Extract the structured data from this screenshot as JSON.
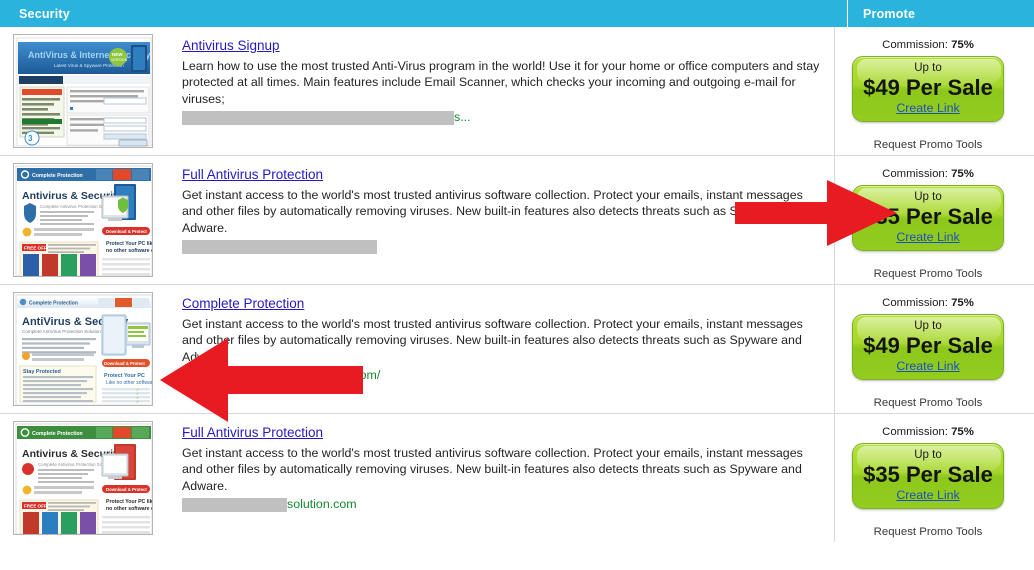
{
  "header": {
    "left_label": "Security",
    "right_label": "Promote"
  },
  "colors": {
    "header_bg": "#2ab4dd",
    "link": "#2419c4",
    "url_green": "#128a2c",
    "button_green": "#93cc1f",
    "arrow_red": "#e81b23",
    "redaction_gray": "#c0c0c0"
  },
  "rows": [
    {
      "thumbnail_name": "antivirus-signup-site-thumbnail",
      "title": "Antivirus Signup",
      "description": "Learn how to use the most trusted Anti-Virus program in the world! Use it for your home or office computers and stay protected at all times. Main features include Email Scanner, which checks your incoming and outgoing e-mail for viruses;",
      "redaction_width": 272,
      "url_suffix": "s...",
      "commission_label": "Commission:",
      "commission_value": "75%",
      "upto_label": "Up to",
      "amount": "$49 Per Sale",
      "create_link": "Create Link",
      "promo_tools": "Request Promo Tools"
    },
    {
      "thumbnail_name": "full-antivirus-protection-site-thumbnail",
      "title": "Full Antivirus Protection",
      "description": "Get instant access to the world's most trusted antivirus software collection. Protect your emails, instant messages and other files by automatically removing viruses. New built-in features also detects threats such as Spyware and Adware.",
      "redaction_width": 195,
      "url_suffix": "",
      "commission_label": "Commission:",
      "commission_value": "75%",
      "upto_label": "Up to",
      "amount": "$35 Per Sale",
      "create_link": "Create Link",
      "promo_tools": "Request Promo Tools"
    },
    {
      "thumbnail_name": "complete-protection-site-thumbnail",
      "title": "Complete Protection",
      "description": "Get instant access to the world's most trusted antivirus software collection. Protect your emails, instant messages and other files by automatically removing viruses. New built-in features also detects threats such as Spyware and Adware.",
      "redaction_width": 168,
      "url_suffix": ".com/",
      "commission_label": "Commission:",
      "commission_value": "75%",
      "upto_label": "Up to",
      "amount": "$49 Per Sale",
      "create_link": "Create Link",
      "promo_tools": "Request Promo Tools"
    },
    {
      "thumbnail_name": "full-antivirus-protection-green-site-thumbnail",
      "title": "Full Antivirus Protection",
      "description": "Get instant access to the world's most trusted antivirus software collection. Protect your emails, instant messages and other files by automatically removing viruses. New built-in features also detects threats such as Spyware and Adware.",
      "redaction_width": 105,
      "url_suffix": "solution.com",
      "commission_label": "Commission:",
      "commission_value": "75%",
      "upto_label": "Up to",
      "amount": "$35 Per Sale",
      "create_link": "Create Link",
      "promo_tools": "Request Promo Tools"
    }
  ],
  "annotations": [
    {
      "name": "right-pointing-arrow",
      "direction": "right",
      "color": "#e81b23"
    },
    {
      "name": "left-pointing-arrow",
      "direction": "left",
      "color": "#e81b23"
    }
  ]
}
